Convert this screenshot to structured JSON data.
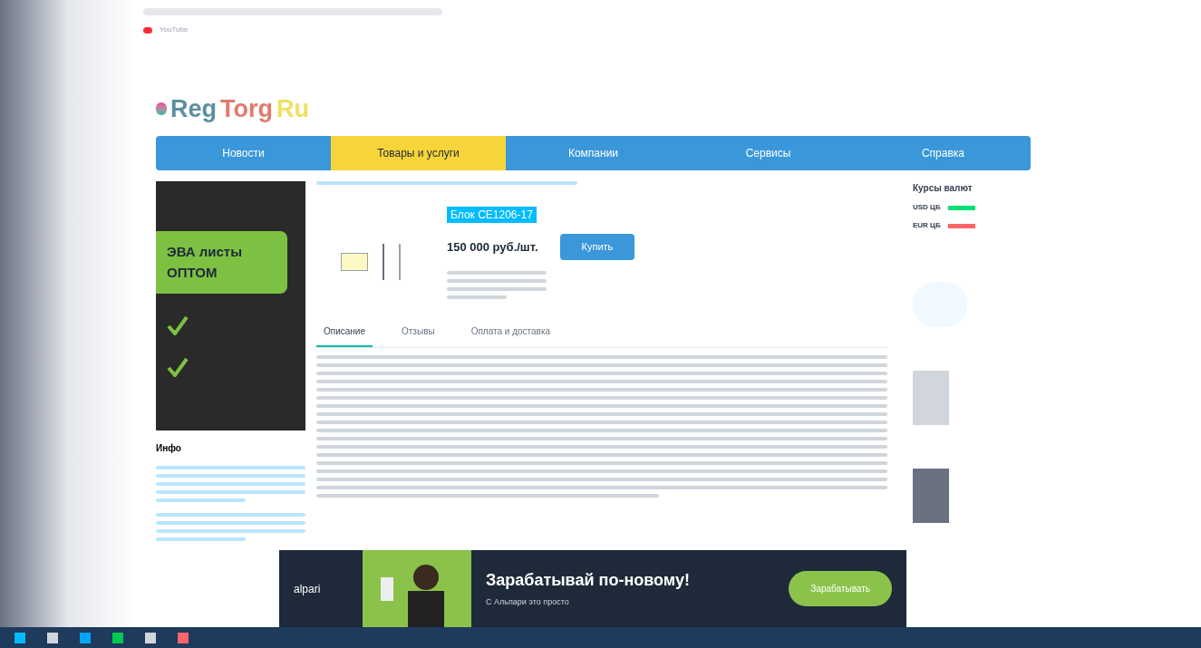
{
  "browser": {
    "bookmarks": [
      "YouTube"
    ]
  },
  "site": {
    "logo": {
      "part1": "Reg",
      "part2": "Torg",
      "part3": "Ru"
    }
  },
  "nav": [
    {
      "label": "Новости",
      "selected": false
    },
    {
      "label": "Товары и услуги",
      "selected": true
    },
    {
      "label": "Компании",
      "selected": false
    },
    {
      "label": "Сервисы",
      "selected": false
    },
    {
      "label": "Справка",
      "selected": false
    }
  ],
  "left_ad": {
    "title": "ЭВА листы ОПТОМ"
  },
  "info": {
    "title": "Инфо"
  },
  "product": {
    "title": "Блок CE1206-17",
    "price": "150 000 руб./шт.",
    "buy": "Купить"
  },
  "tabs": [
    {
      "label": "Описание",
      "selected": true
    },
    {
      "label": "Отзывы",
      "selected": false
    },
    {
      "label": "Оплата и доставка",
      "selected": false
    }
  ],
  "currency": {
    "title": "Курсы валют",
    "rows": [
      {
        "name": "USD ЦБ",
        "kind": "up"
      },
      {
        "name": "EUR ЦБ",
        "kind": "down"
      }
    ]
  },
  "banner": {
    "brand": "alpari",
    "headline": "Зарабатывай по-новому!",
    "subline": "С Альпари это просто",
    "button": "Зарабатывать"
  }
}
